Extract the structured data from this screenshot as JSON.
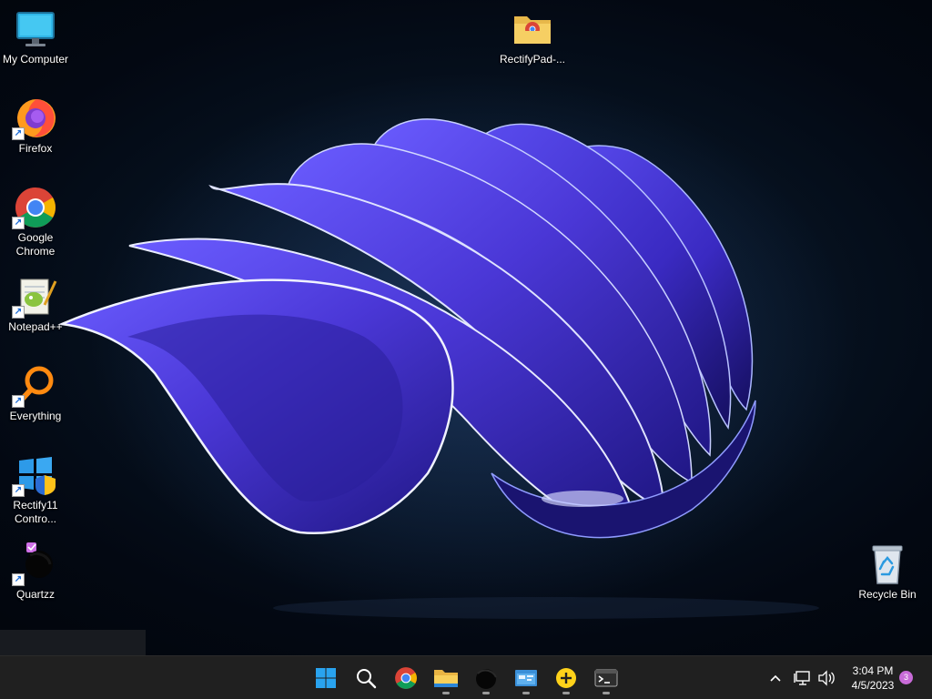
{
  "desktop": {
    "icons": [
      {
        "label": "My Computer",
        "icon": "monitor-icon",
        "shortcut": false
      },
      {
        "label": "Firefox",
        "icon": "firefox-icon",
        "shortcut": true
      },
      {
        "label": "Google Chrome",
        "icon": "chrome-icon",
        "shortcut": true
      },
      {
        "label": "Notepad++",
        "icon": "notepadpp-icon",
        "shortcut": true
      },
      {
        "label": "Everything",
        "icon": "everything-search-icon",
        "shortcut": true
      },
      {
        "label": "Rectify11 Contro...",
        "icon": "rectify11-icon",
        "shortcut": true
      },
      {
        "label": "Quartzz",
        "icon": "quartzz-icon",
        "shortcut": true
      },
      {
        "label": "RectifyPad-...",
        "icon": "folder-chrome-icon",
        "shortcut": false
      },
      {
        "label": "Recycle Bin",
        "icon": "recycle-bin-icon",
        "shortcut": false
      }
    ]
  },
  "taskbar": {
    "apps": [
      {
        "icon": "windows-start-icon",
        "running": false
      },
      {
        "icon": "search-icon",
        "running": false
      },
      {
        "icon": "chrome-icon",
        "running": false
      },
      {
        "icon": "file-explorer-icon",
        "running": true
      },
      {
        "icon": "quartzz-icon",
        "running": true
      },
      {
        "icon": "control-panel-icon",
        "running": true
      },
      {
        "icon": "everything-plus-icon",
        "running": true
      },
      {
        "icon": "terminal-icon",
        "running": true
      }
    ],
    "tray": {
      "chevron": "^",
      "time": "3:04 PM",
      "date": "4/5/2023",
      "notifications": "3"
    }
  },
  "colors": {
    "taskbar": "#202020",
    "wallpaper_accent": "#4f3fe0",
    "notification_badge": "#c86bd8"
  }
}
